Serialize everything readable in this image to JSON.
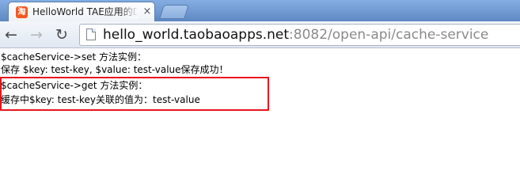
{
  "browser": {
    "tab": {
      "favicon_glyph": "淘",
      "title": "HelloWorld TAE应用的DE",
      "close_glyph": "×"
    },
    "nav": {
      "back_glyph": "←",
      "forward_glyph": "→",
      "reload_glyph": "↻"
    },
    "address_bar": {
      "url_host": "hello_world.taobaoapps.net",
      "url_rest": ":8082/open-api/cache-service"
    }
  },
  "page": {
    "lines": [
      "$cacheService->set 方法实例：",
      "保存 $key: test-key, $value: test-value保存成功！",
      "$cacheService->get 方法实例：",
      "缓存中$key: test-key关联的值为：test-value"
    ]
  },
  "colors": {
    "highlight_border": "#e8141b",
    "tabstrip": "#6b95cf",
    "favicon": "#f05a22"
  }
}
